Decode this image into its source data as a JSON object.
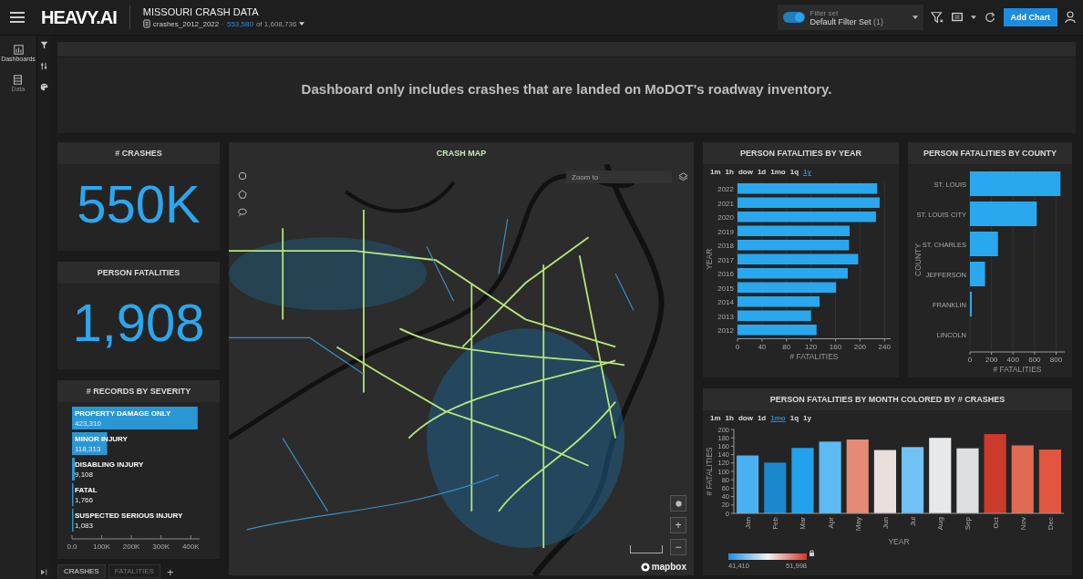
{
  "header": {
    "app_name": "HEAVY.AI",
    "dashboard_title": "MISSOURI CRASH DATA",
    "table_name": "crashes_2012_2022",
    "separator": "·",
    "filtered_count": "553,580",
    "total_count": "of 1,608,736",
    "filter_set": {
      "label": "Filter set",
      "name": "Default Filter Set",
      "count": "(1)",
      "on": true
    },
    "add_chart": "Add Chart"
  },
  "sidebar": {
    "items": [
      {
        "label": "Dashboards",
        "selected": true
      },
      {
        "label": "Data",
        "selected": false
      }
    ]
  },
  "banner": "Dashboard only includes crashes that are landed on MoDOT's roadway inventory.",
  "number_cards": [
    {
      "title": "# CRASHES",
      "value": "550K"
    },
    {
      "title": "PERSON FATALITIES",
      "value": "1,908"
    }
  ],
  "severity_chart": {
    "title": "# RECORDS BY SEVERITY",
    "chart_data": {
      "type": "bar",
      "orientation": "horizontal",
      "categories": [
        "PROPERTY DAMAGE ONLY",
        "MINOR INJURY",
        "DISABLING INJURY",
        "FATAL",
        "SUSPECTED SERIOUS INJURY"
      ],
      "values": [
        423310,
        118313,
        9108,
        1766,
        1083
      ],
      "value_labels": [
        "423,310",
        "118,313",
        "9,108",
        "1,766",
        "1,083"
      ],
      "xlim": [
        0,
        430000
      ],
      "xticks": [
        {
          "value": 0,
          "label": "0.0"
        },
        {
          "value": 100000,
          "label": "100K"
        },
        {
          "value": 200000,
          "label": "200K"
        },
        {
          "value": 300000,
          "label": "300K"
        },
        {
          "value": 400000,
          "label": "400K"
        }
      ]
    }
  },
  "crash_map": {
    "title": "CRASH MAP",
    "zoom_placeholder": "Zoom to",
    "zoom_in": "+",
    "zoom_out": "−",
    "attribution": "mapbox"
  },
  "year_chart": {
    "title": "PERSON FATALITIES BY YEAR",
    "time_bins": [
      {
        "label": "1m",
        "selected": false
      },
      {
        "label": "1h",
        "selected": false
      },
      {
        "label": "dow",
        "selected": false
      },
      {
        "label": "1d",
        "selected": false
      },
      {
        "label": "1mo",
        "selected": false
      },
      {
        "label": "1q",
        "selected": false
      },
      {
        "label": "1y",
        "selected": true
      }
    ],
    "chart_data": {
      "type": "bar",
      "orientation": "horizontal",
      "xlabel": "# FATALITIES",
      "ylabel": "YEAR",
      "categories": [
        "2022",
        "2021",
        "2020",
        "2019",
        "2018",
        "2017",
        "2016",
        "2015",
        "2014",
        "2013",
        "2012"
      ],
      "values": [
        228,
        232,
        226,
        183,
        182,
        197,
        180,
        161,
        134,
        120,
        129
      ],
      "xlim": [
        0,
        250
      ],
      "xticks": [
        0,
        40,
        80,
        120,
        160,
        200,
        240
      ],
      "grid": true
    }
  },
  "county_chart": {
    "title": "PERSON FATALITIES BY COUNTY",
    "chart_data": {
      "type": "bar",
      "orientation": "horizontal",
      "xlabel": "# FATALITIES",
      "ylabel": "COUNTY",
      "categories": [
        "ST. LOUIS",
        "ST. LOUIS CITY",
        "ST. CHARLES",
        "JEFFERSON",
        "FRANKLIN",
        "LINCOLN"
      ],
      "values": [
        840,
        620,
        260,
        140,
        10,
        0
      ],
      "xlim": [
        0,
        880
      ],
      "xticks": [
        0,
        200,
        400,
        600,
        800
      ],
      "grid": true
    }
  },
  "month_chart": {
    "title": "PERSON FATALITIES BY MONTH COLORED BY # CRASHES",
    "time_bins": [
      {
        "label": "1m",
        "selected": false
      },
      {
        "label": "1h",
        "selected": false
      },
      {
        "label": "dow",
        "selected": false
      },
      {
        "label": "1d",
        "selected": false
      },
      {
        "label": "1mo",
        "selected": true
      },
      {
        "label": "1q",
        "selected": false
      },
      {
        "label": "1y",
        "selected": false
      }
    ],
    "chart_data": {
      "type": "bar",
      "xlabel": "YEAR",
      "ylabel": "# FATALITIES",
      "categories": [
        "Jan",
        "Feb",
        "Mar",
        "Apr",
        "May",
        "Jun",
        "Jul",
        "Aug",
        "Sep",
        "Oct",
        "Nov",
        "Dec"
      ],
      "values": [
        138,
        121,
        156,
        171,
        176,
        151,
        158,
        180,
        155,
        189,
        162,
        152
      ],
      "ylim": [
        0,
        200
      ],
      "yticks": [
        0,
        20,
        40,
        60,
        80,
        100,
        120,
        140,
        160,
        180,
        200
      ]
    },
    "bar_fills": [
      {
        "color": "#4ab0ef"
      },
      {
        "color": "#1b87cc"
      },
      {
        "color": "#22a2ec"
      },
      {
        "color": "#5cbbf2"
      },
      {
        "color": "#e58a76"
      },
      {
        "color": "#e8dedc"
      },
      {
        "color": "#6fc2f3"
      },
      {
        "color": "#e6e8ea"
      },
      {
        "color": "#dde0e3"
      },
      {
        "color": "#cc3a2c"
      },
      {
        "color": "#e06a52"
      },
      {
        "color": "#e2553e"
      }
    ],
    "color_legend": {
      "min": "41,410",
      "max": "51,998"
    }
  },
  "tabs": [
    {
      "label": "CRASHES",
      "selected": true
    },
    {
      "label": "FATALITIES",
      "selected": false
    }
  ],
  "add_tab": "+"
}
